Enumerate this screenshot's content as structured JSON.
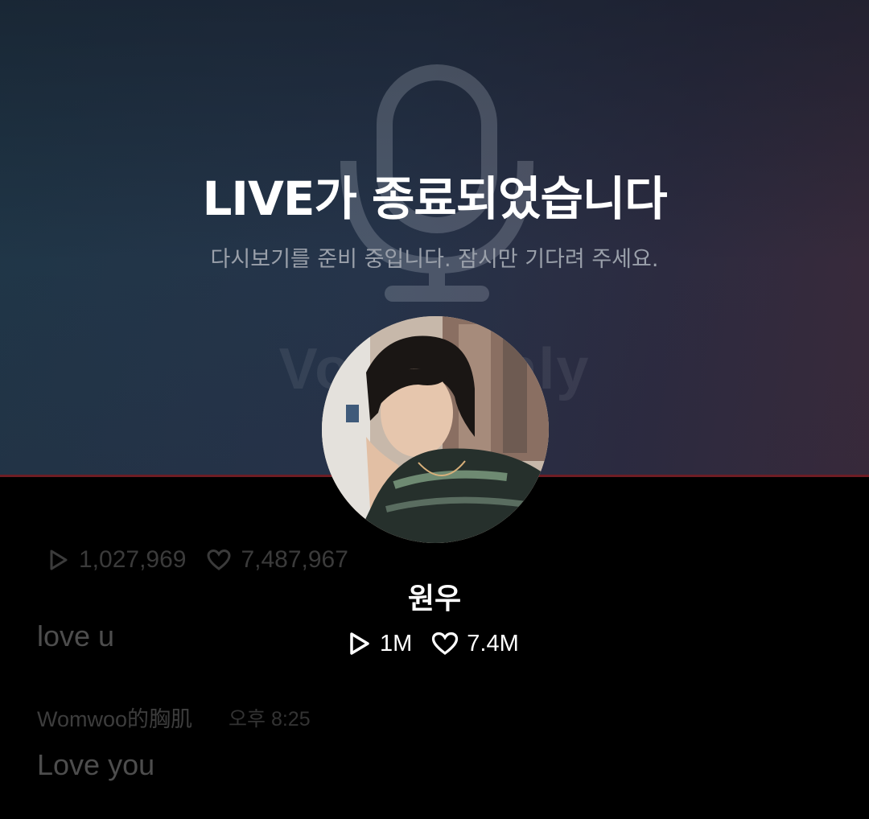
{
  "overlay": {
    "title": "LIVE가 종료되었습니다",
    "subtitle": "다시보기를 준비 중입니다. 잠시만 기다려 주세요.",
    "watermark": "Voice Only",
    "artist_name": "원우",
    "play_count": "1M",
    "like_count": "7.4M"
  },
  "background": {
    "play_count": "1,027,969",
    "like_count": "7,487,967",
    "comments": [
      {
        "text": "love u"
      },
      {
        "user": "Womwoo的胸肌",
        "time": "오후 8:25",
        "text": "Love you"
      }
    ]
  },
  "colors": {
    "accent_line": "#6e1d24",
    "title": "#ffffff",
    "subtitle": "#9aa0aa"
  },
  "icons": [
    "mic-icon",
    "play-icon",
    "heart-icon"
  ]
}
